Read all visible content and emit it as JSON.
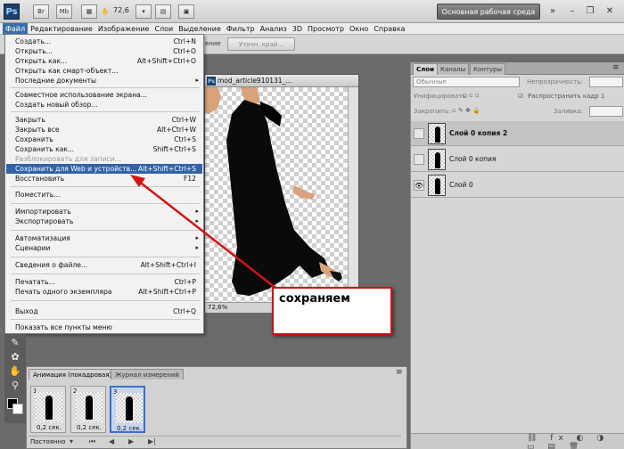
{
  "app": {
    "logo": "Ps",
    "toolbar_icons": [
      "Br",
      "Mb"
    ],
    "zoom": "72,6",
    "workspace": "Основная рабочая среда"
  },
  "menubar": [
    "Файл",
    "Редактирование",
    "Изображение",
    "Слои",
    "Выделение",
    "Фильтр",
    "Анализ",
    "3D",
    "Просмотр",
    "Окно",
    "Справка"
  ],
  "optbar": {
    "refine_edge": "Уточн. край...",
    "partial_label": "ение"
  },
  "file_menu": [
    {
      "label": "Создать...",
      "shortcut": "Ctrl+N"
    },
    {
      "label": "Открыть...",
      "shortcut": "Ctrl+O"
    },
    {
      "label": "Открыть как...",
      "shortcut": "Alt+Shift+Ctrl+O"
    },
    {
      "label": "Открыть как смарт-объект...",
      "shortcut": ""
    },
    {
      "label": "Последние документы",
      "shortcut": "",
      "submenu": true
    },
    {
      "label": "Совместное использование экрана...",
      "shortcut": ""
    },
    {
      "label": "Создать новый обзор...",
      "shortcut": ""
    },
    {
      "label": "Закрыть",
      "shortcut": "Ctrl+W"
    },
    {
      "label": "Закрыть все",
      "shortcut": "Alt+Ctrl+W"
    },
    {
      "label": "Сохранить",
      "shortcut": "Ctrl+S"
    },
    {
      "label": "Сохранить как...",
      "shortcut": "Shift+Ctrl+S"
    },
    {
      "label": "Разблокировать для записи...",
      "shortcut": "",
      "disabled": true
    },
    {
      "label": "Сохранить для Web и устройств...",
      "shortcut": "Alt+Shift+Ctrl+S",
      "highlighted": true
    },
    {
      "label": "Восстановить",
      "shortcut": "F12"
    },
    {
      "label": "Поместить...",
      "shortcut": ""
    },
    {
      "label": "Импортировать",
      "shortcut": "",
      "submenu": true
    },
    {
      "label": "Экспортировать",
      "shortcut": "",
      "submenu": true
    },
    {
      "label": "Автоматизация",
      "shortcut": "",
      "submenu": true
    },
    {
      "label": "Сценарии",
      "shortcut": "",
      "submenu": true
    },
    {
      "label": "Сведения о файле...",
      "shortcut": "Alt+Shift+Ctrl+I"
    },
    {
      "label": "Печатать...",
      "shortcut": "Ctrl+P"
    },
    {
      "label": "Печать одного экземпляра",
      "shortcut": "Alt+Shift+Ctrl+P"
    },
    {
      "label": "Выход",
      "shortcut": "Ctrl+Q"
    },
    {
      "label": "Показать все пункты меню",
      "shortcut": ""
    }
  ],
  "document": {
    "title": "mod_article910131_...",
    "zoom": "72,6%"
  },
  "layers_panel": {
    "tabs": [
      "Слои",
      "Каналы",
      "Контуры"
    ],
    "blend_mode": "Обычные",
    "opacity_label": "Непрозрачность:",
    "unify_label": "Унифицировать:",
    "propagate_label": "Распространить кадр 1",
    "lock_label": "Закрепить:",
    "fill_label": "Заливка:",
    "layers": [
      {
        "name": "Слой 0 копия 2",
        "selected": true,
        "visible": false
      },
      {
        "name": "Слой 0 копия",
        "selected": false,
        "visible": false
      },
      {
        "name": "Слой 0",
        "selected": false,
        "visible": true
      }
    ]
  },
  "animation_panel": {
    "tabs": [
      "Анимация (покадровая)",
      "Журнал измерений"
    ],
    "frames": [
      {
        "num": "1",
        "delay": "0,2 сек."
      },
      {
        "num": "2",
        "delay": "0,2 сек."
      },
      {
        "num": "3",
        "delay": "0,2 сек."
      }
    ],
    "loop": "Постоянно"
  },
  "callout": {
    "text": "сохраняем",
    "color": "#cc1111"
  }
}
